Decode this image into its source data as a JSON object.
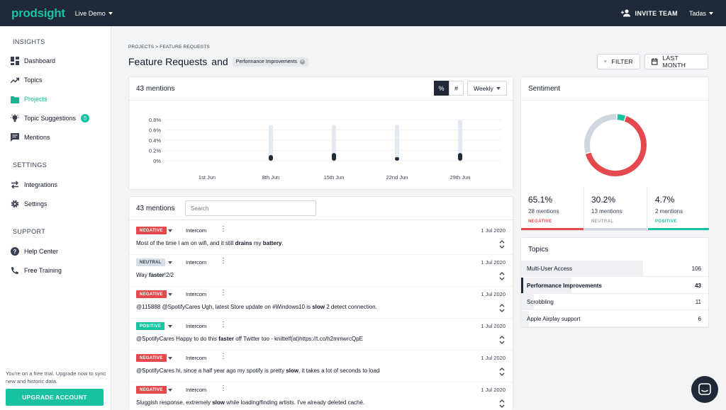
{
  "header": {
    "logo": "prodsight",
    "workspace": "Live Demo",
    "invite": "INVITE TEAM",
    "user": "Tadas"
  },
  "sidebar": {
    "insights_title": "INSIGHTS",
    "dashboard": "Dashboard",
    "topics": "Topics",
    "projects": "Projects",
    "topic_suggestions": "Topic Suggestions",
    "topic_suggestions_count": "5",
    "mentions": "Mentions",
    "settings_title": "SETTINGS",
    "integrations": "Integrations",
    "settings": "Settings",
    "support_title": "SUPPORT",
    "help_center": "Help Center",
    "free_training": "Free Training",
    "trial_text": "You're on a free trial. Upgrade now to sync new and historic data.",
    "upgrade": "UPGRADE ACCOUNT"
  },
  "page": {
    "breadcrumb": "PROJECTS > FEATURE REQUESTS",
    "title": "Feature Requests",
    "and": "and",
    "chip": "Performance Improvements",
    "filter": "FILTER",
    "period": "LAST MONTH"
  },
  "chart_card": {
    "title": "43 mentions",
    "pct": "%",
    "num": "#",
    "interval": "Weekly"
  },
  "chart_data": {
    "type": "bar",
    "categories": [
      "1st Jun",
      "8th Jun",
      "15th Jun",
      "22nd Jun",
      "29th Jun"
    ],
    "y_ticks": [
      "0.8%",
      "0.6%",
      "0.4%",
      "0.2%",
      "0%"
    ],
    "ylim": [
      0,
      0.8
    ],
    "series": [
      {
        "values": [
          null,
          0.7,
          0.7,
          0.7,
          0.8
        ]
      },
      {
        "values": [
          null,
          0.11,
          0.15,
          0.07,
          0.15
        ]
      }
    ]
  },
  "mentions_card": {
    "title": "43 mentions",
    "search_placeholder": "Search",
    "items": [
      {
        "sentiment": "NEGATIVE",
        "source": "Intercom",
        "date": "1 Jul 2020",
        "parts": [
          "Most of the time I am on wifi, and it still ",
          "drains",
          " my ",
          "battery",
          "."
        ]
      },
      {
        "sentiment": "NEUTRAL",
        "source": "Intercom",
        "date": "1 Jul 2020",
        "parts": [
          "Way ",
          "faster",
          "!2/2",
          "",
          ""
        ]
      },
      {
        "sentiment": "NEGATIVE",
        "source": "Intercom",
        "date": "1 Jul 2020",
        "parts": [
          "@115888 @SpotifyCares Ugh, latest Store update on #Windows10 is ",
          "slow",
          " 2 detect connection.",
          "",
          ""
        ]
      },
      {
        "sentiment": "POSITIVE",
        "source": "Intercom",
        "date": "1 Jul 2020",
        "parts": [
          "@SpotifyCares Happy to do this ",
          "faster",
          " off Twitter too - knittelf(at)https://t.co/h2mmwrcQpE",
          "",
          ""
        ]
      },
      {
        "sentiment": "NEGATIVE",
        "source": "Intercom",
        "date": "1 Jul 2020",
        "parts": [
          "@SpotifyCares hi, since a half year ago my spotify is pretty ",
          "slow",
          ", it takes a lot of seconds to load",
          "",
          ""
        ]
      },
      {
        "sentiment": "NEGATIVE",
        "source": "Intercom",
        "date": "1 Jul 2020",
        "parts": [
          "Sluggish response, extremely ",
          "slow",
          " while loading/finding artists. I've already deleted caché.",
          "",
          ""
        ]
      }
    ]
  },
  "sentiment": {
    "title": "Sentiment",
    "stats": [
      {
        "pct": "65.1%",
        "count": "28 mentions",
        "label": "NEGATIVE",
        "value": 65.1,
        "color": "#e5484d"
      },
      {
        "pct": "30.2%",
        "count": "13 mentions",
        "label": "NEUTRAL",
        "value": 30.2,
        "color": "#cfd6df"
      },
      {
        "pct": "4.7%",
        "count": "2 mentions",
        "label": "POSITIVE",
        "value": 4.7,
        "color": "#19c2a0"
      }
    ]
  },
  "topics": {
    "title": "Topics",
    "items": [
      {
        "name": "Multi-User Access",
        "value": "106",
        "share": 0.65
      },
      {
        "name": "Performance Improvements",
        "value": "43",
        "share": 0.27
      },
      {
        "name": "Scrobbling",
        "value": "11",
        "share": 0.07
      },
      {
        "name": "Apple Airplay support",
        "value": "6",
        "share": 0.04
      }
    ]
  }
}
